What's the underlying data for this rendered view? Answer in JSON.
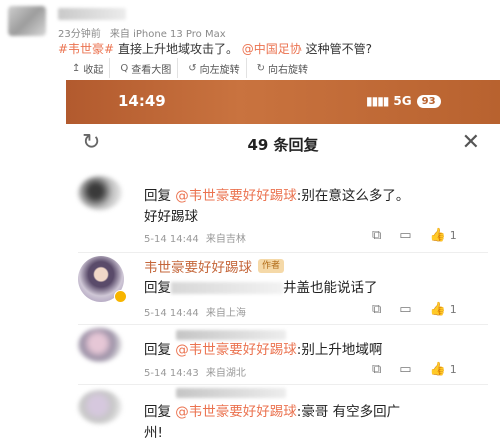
{
  "post": {
    "time": "23分钟前",
    "source": "来自 iPhone 13 Pro Max",
    "text_tag": "#韦世豪#",
    "text_main": " 直接上升地域攻击了。 ",
    "text_mention": "@中国足协",
    "text_end": " 这种管不管?"
  },
  "toolbar": {
    "collapse_label": "收起",
    "view_large_label": "查看大图",
    "rotate_left_label": "向左旋转",
    "rotate_right_label": "向右旋转",
    "collapse_icon": "↥",
    "search_icon": "Q",
    "rotate_left_icon": "↺",
    "rotate_right_icon": "↻"
  },
  "phone": {
    "time": "14:49",
    "signal": "▮▮▮▮",
    "network": "5G",
    "battery": "93"
  },
  "sheet": {
    "title": "49 条回复",
    "refresh_icon": "↻",
    "close_icon": "✕"
  },
  "comments": [
    {
      "reply_prefix": "回复",
      "at_user": "@韦世豪要好好踢球",
      "text": ":别在意这么多了。",
      "text_line2": "好好踢球",
      "date": "5-14 14:44",
      "location": "来自吉林",
      "likes": "1"
    },
    {
      "author": "韦世豪要好好踢球",
      "author_badge": "作者",
      "reply_prefix": "回复",
      "text": "井盖也能说话了",
      "date": "5-14 14:44",
      "location": "来自上海",
      "likes": "1"
    },
    {
      "reply_prefix": "回复",
      "at_user": "@韦世豪要好好踢球",
      "text": ":别上升地域啊",
      "date": "5-14 14:43",
      "location": "来自湖北",
      "likes": "1"
    },
    {
      "reply_prefix": "回复",
      "at_user": "@韦世豪要好好踢球",
      "text": ":豪哥 有空多回广",
      "text_line2": "州!"
    }
  ],
  "icons": {
    "share": "⧉",
    "comment": "▭",
    "like": "👍"
  },
  "colors": {
    "accent": "#eb7350",
    "status_bar": "#b8622f"
  }
}
